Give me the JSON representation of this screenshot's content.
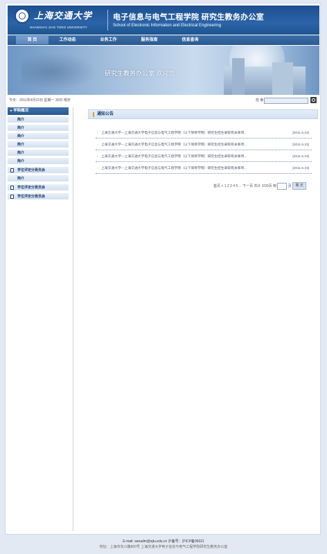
{
  "header": {
    "university_cn": "上海交通大学",
    "university_en": "SHANGHAI JIAO TONG UNIVERSITY",
    "site_title": "电子信息与电气工程学院  研究生教务办公室",
    "site_subtitle": "School of Electronic Information and Electrical Engineering"
  },
  "nav": {
    "items": [
      {
        "label": "首 页",
        "active": true
      },
      {
        "label": "工作动态",
        "active": false
      },
      {
        "label": "业务工作",
        "active": false
      },
      {
        "label": "服务指南",
        "active": false
      },
      {
        "label": "信息查询",
        "active": false
      }
    ]
  },
  "banner": {
    "text": "研究生教务办公室  欢迎您"
  },
  "infobar": {
    "date_text": "今天：2011年4月23日  星期一  30日 晴天",
    "search_label": "检 索",
    "search_value": ""
  },
  "sidebar": {
    "header": "▸ 学院概况",
    "items": [
      {
        "label": "简介",
        "doc_icon": false
      },
      {
        "label": "简介",
        "doc_icon": false
      },
      {
        "label": "简介",
        "doc_icon": false
      },
      {
        "label": "简介",
        "doc_icon": false
      },
      {
        "label": "简介",
        "doc_icon": false
      },
      {
        "label": "简介",
        "doc_icon": false
      },
      {
        "label": "学位评定分委员会",
        "doc_icon": true
      },
      {
        "label": "简介",
        "doc_icon": false
      },
      {
        "label": "学位评定分委员会",
        "doc_icon": true
      },
      {
        "label": "学位评定分委员会",
        "doc_icon": true
      }
    ]
  },
  "main": {
    "section_title": "通知公告",
    "news": [
      {
        "title": "上海交通大学—上海交通大学电子信息与电气工程学院（以下简称学院）研究生招生录取有关事项...",
        "date": "[2011.5.23]"
      },
      {
        "title": "上海交通大学—上海交通大学电子信息与电气工程学院（以下简称学院）研究生招生录取有关事项...",
        "date": "[2011.5.23]"
      },
      {
        "title": "上海交通大学—上海交通大学电子信息与电气工程学院（以下简称学院）研究生招生录取有关事项...",
        "date": "[2011.5.23]"
      },
      {
        "title": "上海交通大学—上海交通大学电子信息与电气工程学院（以下简称学院）研究生招生录取有关事项...",
        "date": "[2011.5.23]"
      }
    ],
    "pager": {
      "text": "首页 < 1 2 3 4 5 ... 下一页  共计 2/30页 到",
      "unit": "页",
      "go_label": "确 定"
    }
  },
  "footer": {
    "line1": "E-mail: seeadm@sjtu.edu.cn  沪备号：沪ICP备05021",
    "line2": "地址：上海市东川路800号  上海交通大学电子信息与电气工程学院研究生教务办公室"
  }
}
